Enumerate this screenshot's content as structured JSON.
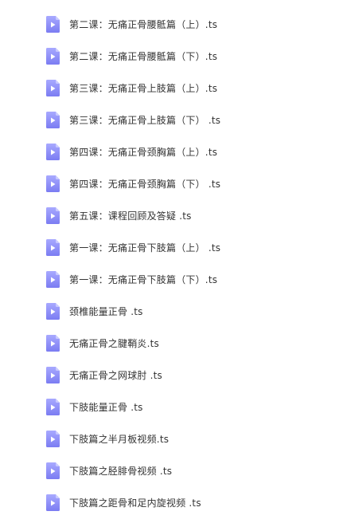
{
  "icon_name": "video-file-icon",
  "colors": {
    "icon_top": "#a8a9ff",
    "icon_bottom": "#7b7cf2",
    "icon_fold": "#c9caff",
    "icon_play": "#ffffff",
    "text": "#333333"
  },
  "files": [
    {
      "name": "第二课：无痛正骨腰骶篇（上）.ts"
    },
    {
      "name": "第二课：无痛正骨腰骶篇（下）.ts"
    },
    {
      "name": "第三课：无痛正骨上肢篇（上）.ts"
    },
    {
      "name": "第三课：无痛正骨上肢篇（下） .ts"
    },
    {
      "name": "第四课：无痛正骨颈胸篇（上）.ts"
    },
    {
      "name": "第四课：无痛正骨颈胸篇（下） .ts"
    },
    {
      "name": "第五课：课程回顾及答疑 .ts"
    },
    {
      "name": "第一课：无痛正骨下肢篇（上） .ts"
    },
    {
      "name": "第一课：无痛正骨下肢篇（下）.ts"
    },
    {
      "name": "颈椎能量正骨 .ts"
    },
    {
      "name": "无痛正骨之腱鞘炎.ts"
    },
    {
      "name": "无痛正骨之网球肘 .ts"
    },
    {
      "name": "下肢能量正骨 .ts"
    },
    {
      "name": "下肢篇之半月板视频.ts"
    },
    {
      "name": "下肢篇之胫腓骨视频 .ts"
    },
    {
      "name": "下肢篇之距骨和足内旋视频 .ts"
    }
  ]
}
